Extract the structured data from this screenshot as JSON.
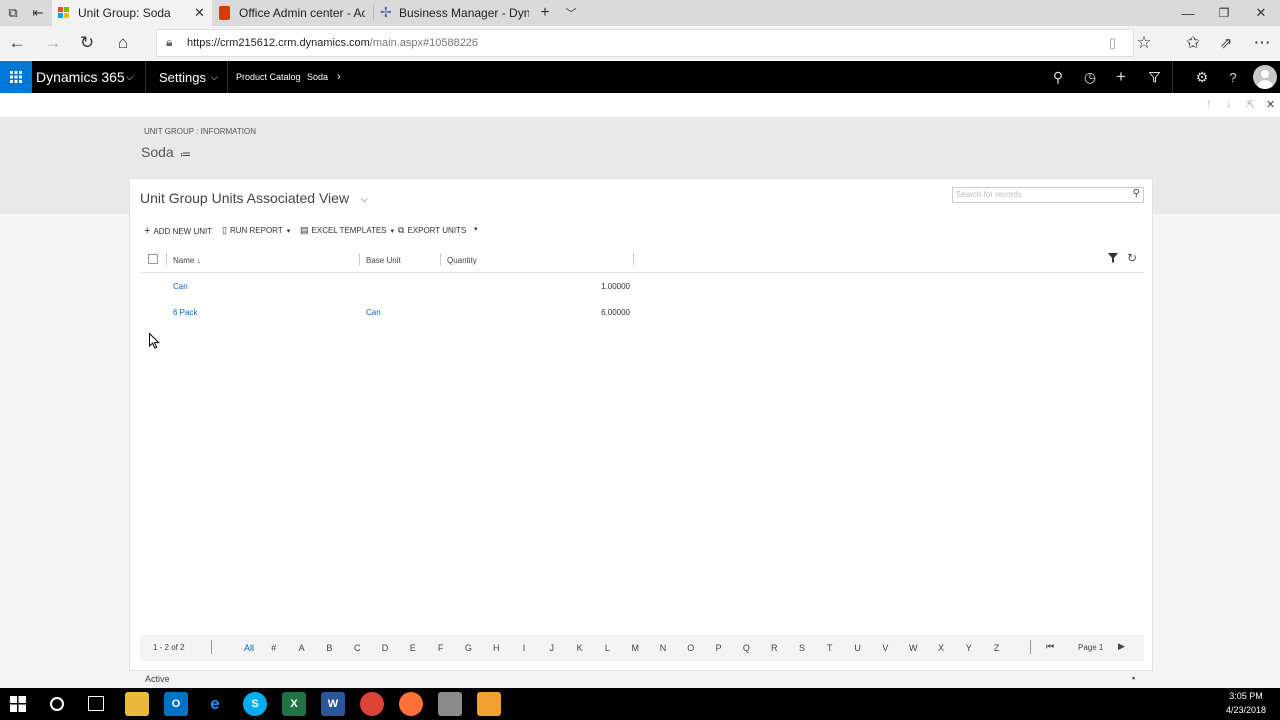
{
  "browser": {
    "tabs": [
      {
        "label": "Unit Group: Soda",
        "active": true
      },
      {
        "label": "Office Admin center - Activ",
        "active": false
      },
      {
        "label": "Business Manager - Dynam",
        "active": false
      }
    ],
    "url_host": "https://crm215612.crm.dynamics.com",
    "url_path": "/main.aspx#10588226"
  },
  "crm_nav": {
    "app_name": "Dynamics 365",
    "area": "Settings",
    "breadcrumb_1": "Product Catalog",
    "breadcrumb_2": "Soda"
  },
  "form": {
    "entity_label": "UNIT GROUP : INFORMATION",
    "record_name": "Soda"
  },
  "view": {
    "title": "Unit Group Units Associated View",
    "search_placeholder": "Search for records",
    "commands": {
      "add": "ADD NEW UNIT",
      "run_report": "RUN REPORT",
      "excel": "EXCEL TEMPLATES",
      "export": "EXPORT UNITS"
    },
    "columns": {
      "name": "Name",
      "base_unit": "Base Unit",
      "quantity": "Quantity"
    },
    "rows": [
      {
        "name": "Can",
        "base_unit": "",
        "quantity": "1.00000"
      },
      {
        "name": "6 Pack",
        "base_unit": "Can",
        "quantity": "6.00000"
      }
    ],
    "record_count": "1 - 2 of 2",
    "letters": [
      "All",
      "#",
      "A",
      "B",
      "C",
      "D",
      "E",
      "F",
      "G",
      "H",
      "I",
      "J",
      "K",
      "L",
      "M",
      "N",
      "O",
      "P",
      "Q",
      "R",
      "S",
      "T",
      "U",
      "V",
      "W",
      "X",
      "Y",
      "Z"
    ],
    "page_label": "Page 1"
  },
  "status": {
    "state": "Active"
  },
  "taskbar": {
    "time": "3:05 PM",
    "date": "4/23/2018"
  },
  "colors": {
    "accent": "#0078d7",
    "link": "#1160b7",
    "crm_bar": "#000000"
  }
}
